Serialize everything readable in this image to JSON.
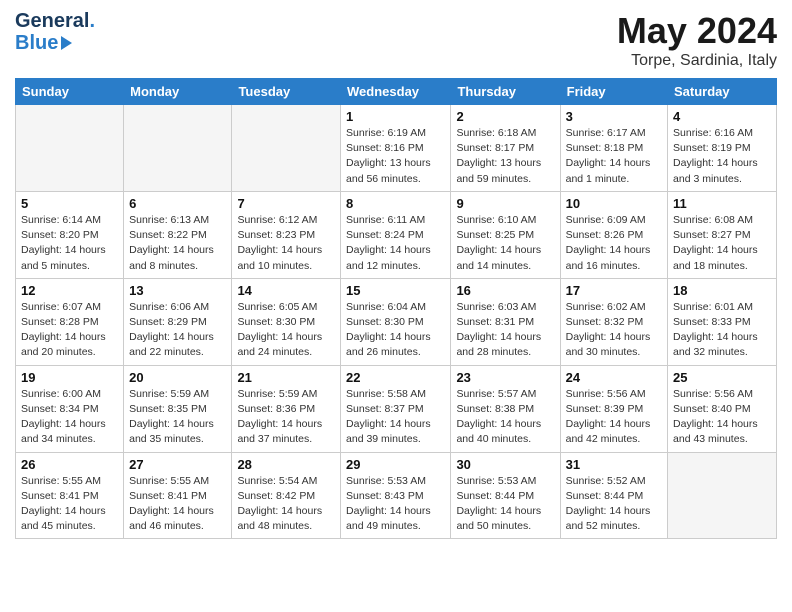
{
  "header": {
    "logo_line1": "General",
    "logo_line2": "Blue",
    "month": "May 2024",
    "location": "Torpe, Sardinia, Italy"
  },
  "weekdays": [
    "Sunday",
    "Monday",
    "Tuesday",
    "Wednesday",
    "Thursday",
    "Friday",
    "Saturday"
  ],
  "weeks": [
    [
      {
        "day": "",
        "info": ""
      },
      {
        "day": "",
        "info": ""
      },
      {
        "day": "",
        "info": ""
      },
      {
        "day": "1",
        "info": "Sunrise: 6:19 AM\nSunset: 8:16 PM\nDaylight: 13 hours and 56 minutes."
      },
      {
        "day": "2",
        "info": "Sunrise: 6:18 AM\nSunset: 8:17 PM\nDaylight: 13 hours and 59 minutes."
      },
      {
        "day": "3",
        "info": "Sunrise: 6:17 AM\nSunset: 8:18 PM\nDaylight: 14 hours and 1 minute."
      },
      {
        "day": "4",
        "info": "Sunrise: 6:16 AM\nSunset: 8:19 PM\nDaylight: 14 hours and 3 minutes."
      }
    ],
    [
      {
        "day": "5",
        "info": "Sunrise: 6:14 AM\nSunset: 8:20 PM\nDaylight: 14 hours and 5 minutes."
      },
      {
        "day": "6",
        "info": "Sunrise: 6:13 AM\nSunset: 8:22 PM\nDaylight: 14 hours and 8 minutes."
      },
      {
        "day": "7",
        "info": "Sunrise: 6:12 AM\nSunset: 8:23 PM\nDaylight: 14 hours and 10 minutes."
      },
      {
        "day": "8",
        "info": "Sunrise: 6:11 AM\nSunset: 8:24 PM\nDaylight: 14 hours and 12 minutes."
      },
      {
        "day": "9",
        "info": "Sunrise: 6:10 AM\nSunset: 8:25 PM\nDaylight: 14 hours and 14 minutes."
      },
      {
        "day": "10",
        "info": "Sunrise: 6:09 AM\nSunset: 8:26 PM\nDaylight: 14 hours and 16 minutes."
      },
      {
        "day": "11",
        "info": "Sunrise: 6:08 AM\nSunset: 8:27 PM\nDaylight: 14 hours and 18 minutes."
      }
    ],
    [
      {
        "day": "12",
        "info": "Sunrise: 6:07 AM\nSunset: 8:28 PM\nDaylight: 14 hours and 20 minutes."
      },
      {
        "day": "13",
        "info": "Sunrise: 6:06 AM\nSunset: 8:29 PM\nDaylight: 14 hours and 22 minutes."
      },
      {
        "day": "14",
        "info": "Sunrise: 6:05 AM\nSunset: 8:30 PM\nDaylight: 14 hours and 24 minutes."
      },
      {
        "day": "15",
        "info": "Sunrise: 6:04 AM\nSunset: 8:30 PM\nDaylight: 14 hours and 26 minutes."
      },
      {
        "day": "16",
        "info": "Sunrise: 6:03 AM\nSunset: 8:31 PM\nDaylight: 14 hours and 28 minutes."
      },
      {
        "day": "17",
        "info": "Sunrise: 6:02 AM\nSunset: 8:32 PM\nDaylight: 14 hours and 30 minutes."
      },
      {
        "day": "18",
        "info": "Sunrise: 6:01 AM\nSunset: 8:33 PM\nDaylight: 14 hours and 32 minutes."
      }
    ],
    [
      {
        "day": "19",
        "info": "Sunrise: 6:00 AM\nSunset: 8:34 PM\nDaylight: 14 hours and 34 minutes."
      },
      {
        "day": "20",
        "info": "Sunrise: 5:59 AM\nSunset: 8:35 PM\nDaylight: 14 hours and 35 minutes."
      },
      {
        "day": "21",
        "info": "Sunrise: 5:59 AM\nSunset: 8:36 PM\nDaylight: 14 hours and 37 minutes."
      },
      {
        "day": "22",
        "info": "Sunrise: 5:58 AM\nSunset: 8:37 PM\nDaylight: 14 hours and 39 minutes."
      },
      {
        "day": "23",
        "info": "Sunrise: 5:57 AM\nSunset: 8:38 PM\nDaylight: 14 hours and 40 minutes."
      },
      {
        "day": "24",
        "info": "Sunrise: 5:56 AM\nSunset: 8:39 PM\nDaylight: 14 hours and 42 minutes."
      },
      {
        "day": "25",
        "info": "Sunrise: 5:56 AM\nSunset: 8:40 PM\nDaylight: 14 hours and 43 minutes."
      }
    ],
    [
      {
        "day": "26",
        "info": "Sunrise: 5:55 AM\nSunset: 8:41 PM\nDaylight: 14 hours and 45 minutes."
      },
      {
        "day": "27",
        "info": "Sunrise: 5:55 AM\nSunset: 8:41 PM\nDaylight: 14 hours and 46 minutes."
      },
      {
        "day": "28",
        "info": "Sunrise: 5:54 AM\nSunset: 8:42 PM\nDaylight: 14 hours and 48 minutes."
      },
      {
        "day": "29",
        "info": "Sunrise: 5:53 AM\nSunset: 8:43 PM\nDaylight: 14 hours and 49 minutes."
      },
      {
        "day": "30",
        "info": "Sunrise: 5:53 AM\nSunset: 8:44 PM\nDaylight: 14 hours and 50 minutes."
      },
      {
        "day": "31",
        "info": "Sunrise: 5:52 AM\nSunset: 8:44 PM\nDaylight: 14 hours and 52 minutes."
      },
      {
        "day": "",
        "info": ""
      }
    ]
  ]
}
